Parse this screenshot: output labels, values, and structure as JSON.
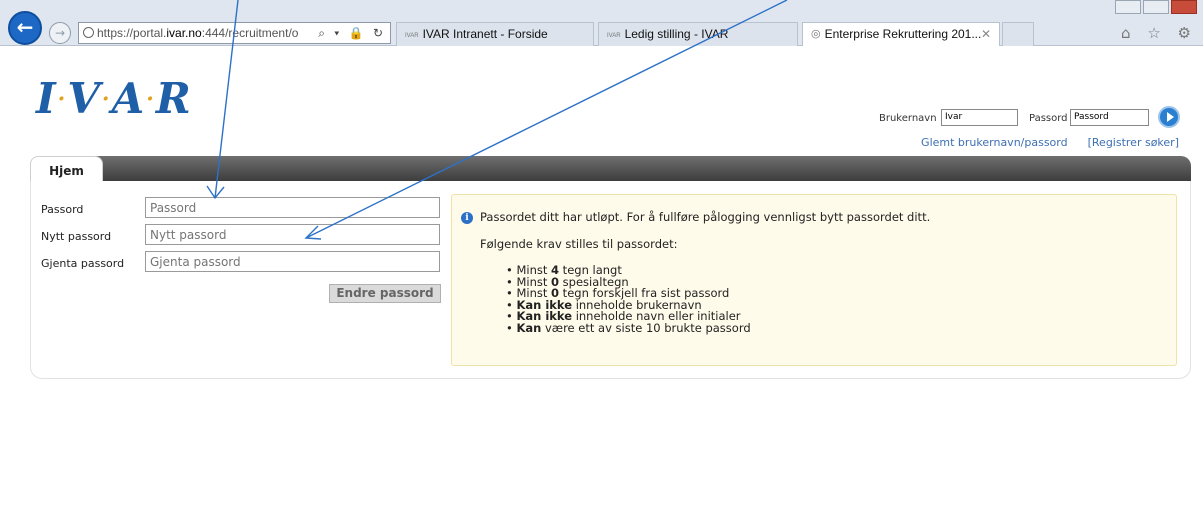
{
  "browser": {
    "back_icon": "back-arrow-icon",
    "forward_icon": "forward-arrow-icon",
    "address": {
      "prefix": "https://portal.",
      "host": "ivar.no",
      "suffix": ":444/recruitment/o",
      "tools": "⌕ ▾ 🔒 ↻"
    },
    "tabs": [
      {
        "label": "IVAR Intranett - Forside",
        "active": false
      },
      {
        "label": "Ledig stilling - IVAR",
        "active": false
      },
      {
        "label": "Enterprise Rekruttering 201...",
        "active": true
      }
    ],
    "tab_close": "✕",
    "tool_icons": "⌂ ☆ ⚙"
  },
  "header": {
    "logo_letters": [
      "I",
      "V",
      "A",
      "R"
    ],
    "logo_separator": "·",
    "login": {
      "username_label": "Brukernavn",
      "username_value": "Ivar",
      "password_label": "Passord",
      "password_value": "Passord"
    },
    "links": {
      "forgot": "Glemt brukernavn/passord",
      "register": "[Registrer søker]"
    }
  },
  "nav": {
    "home_tab": "Hjem"
  },
  "form": {
    "password_label": "Passord",
    "password_placeholder": "Passord",
    "new_password_label": "Nytt passord",
    "new_password_placeholder": "Nytt passord",
    "repeat_password_label": "Gjenta passord",
    "repeat_password_placeholder": "Gjenta passord",
    "submit_label": "Endre passord"
  },
  "info": {
    "icon": "i",
    "message": "Passordet ditt har utløpt. For å fullføre pålogging vennligst bytt passordet ditt.",
    "requirements_heading": "Følgende krav stilles til passordet:",
    "requirements": [
      {
        "pre": "Minst ",
        "bold": "4",
        "post": " tegn langt"
      },
      {
        "pre": "Minst ",
        "bold": "0",
        "post": " spesialtegn"
      },
      {
        "pre": "Minst ",
        "bold": "0",
        "post": " tegn forskjell fra sist passord"
      },
      {
        "pre": "",
        "bold": "Kan ikke",
        "post": " inneholde brukernavn"
      },
      {
        "pre": "",
        "bold": "Kan ikke",
        "post": " inneholde navn eller initialer"
      },
      {
        "pre": "",
        "bold": "Kan",
        "post": " være ett av siste 10 brukte passord"
      }
    ]
  },
  "colors": {
    "brand_blue": "#1f5fa7",
    "logo_dot": "#e0a21b",
    "link_blue": "#3d6fb3",
    "info_bg": "#fffbea",
    "annotation_arrow": "#2d72c6"
  }
}
